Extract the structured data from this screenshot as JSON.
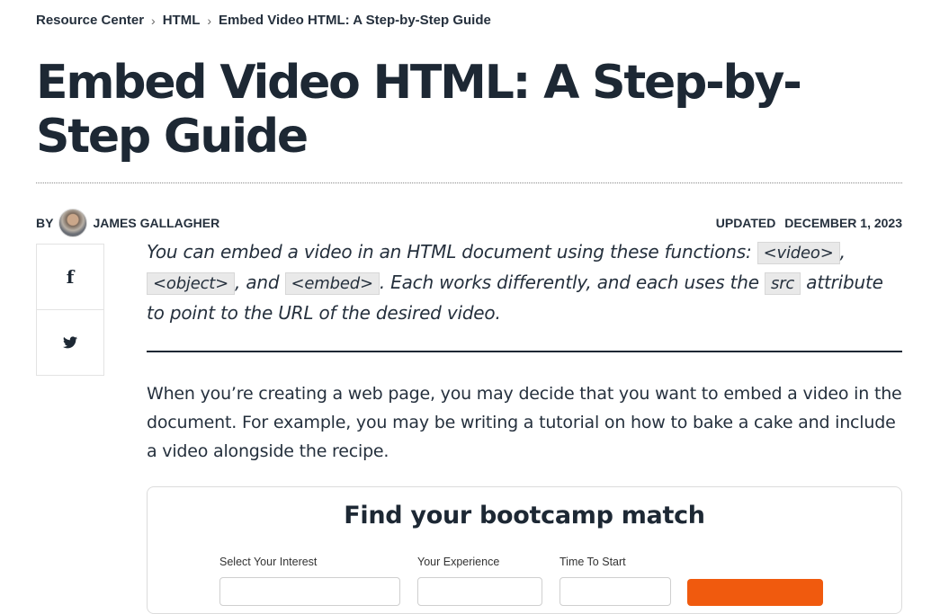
{
  "breadcrumb": {
    "items": [
      "Resource Center",
      "HTML",
      "Embed Video HTML: A Step-by-Step Guide"
    ],
    "separator": "›"
  },
  "article": {
    "title": "Embed Video HTML: A Step-by-Step Guide",
    "by_label": "BY",
    "author": "JAMES GALLAGHER",
    "updated_label": "UPDATED",
    "updated_date": "DECEMBER 1, 2023"
  },
  "share": {
    "facebook_glyph": "f",
    "twitter_glyph": "🐦"
  },
  "intro": {
    "part1": "You can embed a video in an HTML document using these functions: ",
    "code1": "<video>",
    "sep1": ", ",
    "code2": "<object>",
    "sep2": ", and ",
    "code3": "<embed>",
    "part2": ". Each works differently, and each uses the ",
    "code4": "src",
    "part3": " attribute to point to the URL of the desired video."
  },
  "body": {
    "paragraph1": "When you’re creating a web page, you may decide that you want to embed a video in the document. For example, you may be writing a tutorial on how to bake a cake and include a video alongside the recipe."
  },
  "bootcamp_widget": {
    "title": "Find your bootcamp match",
    "interest_label": "Select Your Interest",
    "experience_label": "Your Experience",
    "time_label": "Time To Start"
  },
  "colors": {
    "text": "#1d2834",
    "cta": "#f05a0e"
  }
}
